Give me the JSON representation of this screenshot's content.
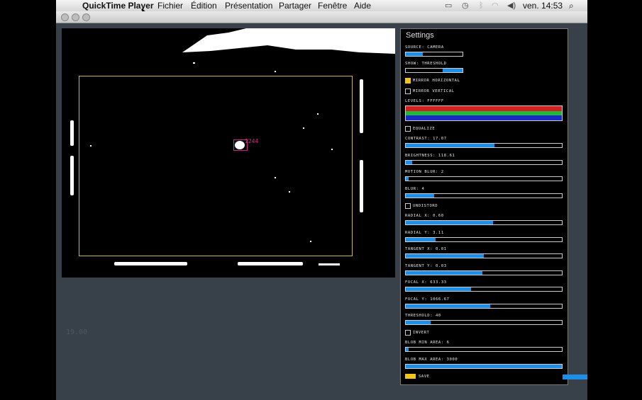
{
  "menubar": {
    "app_name": "QuickTime Player",
    "menus": [
      "Fichier",
      "Édition",
      "Présentation",
      "Partager",
      "Fenêtre",
      "Aide"
    ],
    "clock": "ven. 14:53"
  },
  "video": {
    "blob_label": "1244"
  },
  "fps": "19.00",
  "settings": {
    "title": "Settings",
    "source_label": "SOURCE: CAMERA",
    "source_value": 0.3,
    "show_label": "SHOW: THRESHOLD",
    "show_value": 0.75,
    "mirror_h_label": "MIRROR HORIZONTAL",
    "mirror_h_checked": true,
    "mirror_v_label": "MIRROR VERTICAL",
    "mirror_v_checked": false,
    "levels_label": "LEVELS: FFFFFF",
    "levels_colors": [
      "#d0201f",
      "#1fb83a",
      "#1b29c7"
    ],
    "equalize_label": "EQUALIZE",
    "equalize_checked": false,
    "sliders_a": [
      {
        "label": "CONTRAST: 17.07",
        "value": 0.57
      },
      {
        "label": "BRIGHTNESS: 118.61",
        "value": 0.04
      },
      {
        "label": "MOTION BLUR: 2",
        "value": 0.02
      },
      {
        "label": "BLUR: 4",
        "value": 0.18
      }
    ],
    "undistort_label": "UNDISTORD",
    "undistort_checked": false,
    "sliders_b": [
      {
        "label": "RADIAL X: 0.60",
        "value": 0.56
      },
      {
        "label": "RADIAL Y: 3.11",
        "value": 0.19
      },
      {
        "label": "TANGENT X: 0.01",
        "value": 0.5
      },
      {
        "label": "TANGENT Y: 0.03",
        "value": 0.49
      },
      {
        "label": "FOCAL X: 633.33",
        "value": 0.42
      },
      {
        "label": "FOCAL Y: 1066.67",
        "value": 0.54
      },
      {
        "label": "THRESHOLD: 40",
        "value": 0.16
      }
    ],
    "invert_label": "INVERT",
    "invert_checked": false,
    "sliders_c": [
      {
        "label": "BLOB MIN AREA: 6",
        "value": 0.02
      },
      {
        "label": "BLOB MAX AREA: 3000",
        "value": 1.0
      }
    ],
    "save_label": "SAVE"
  }
}
